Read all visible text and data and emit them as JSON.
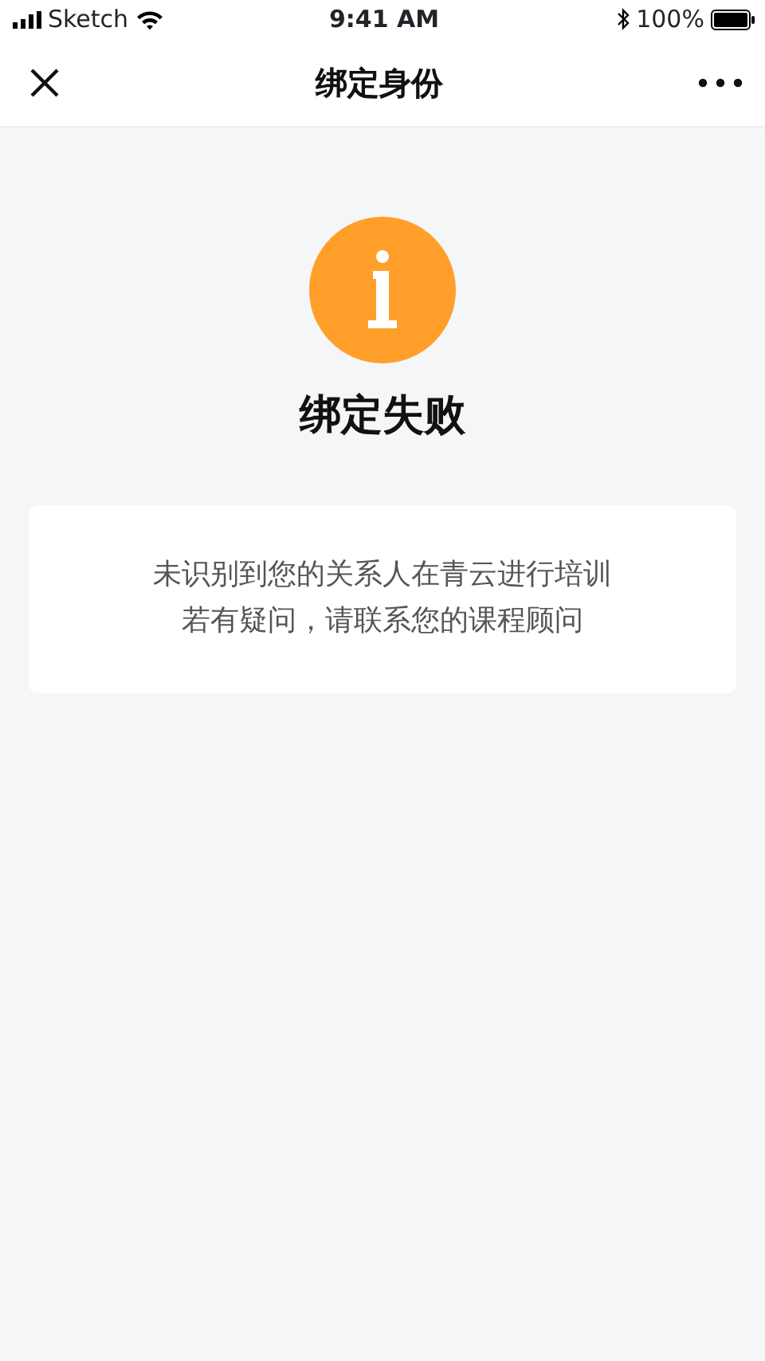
{
  "status_bar": {
    "carrier": "Sketch",
    "time": "9:41 AM",
    "battery": "100%"
  },
  "nav": {
    "title": "绑定身份"
  },
  "result": {
    "title": "绑定失败",
    "message_lines": [
      "未识别到您的关系人在青云进行培训",
      "若有疑问，请联系您的课程顾问"
    ]
  }
}
